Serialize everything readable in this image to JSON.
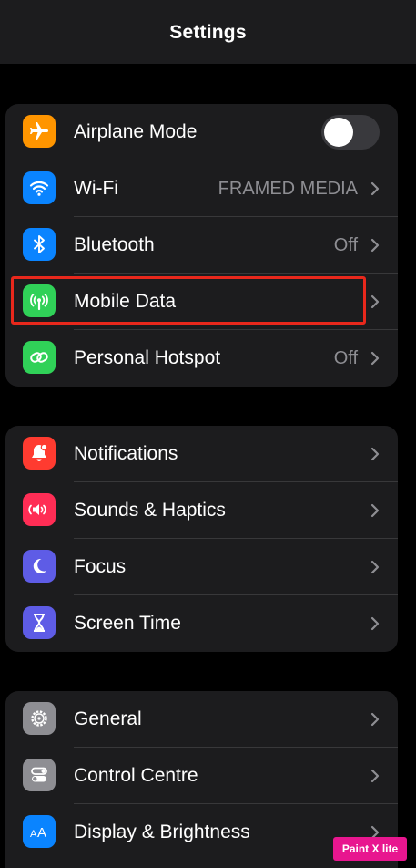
{
  "header": {
    "title": "Settings"
  },
  "group1": {
    "items": [
      {
        "label": "Airplane Mode",
        "icon": "airplane-icon",
        "color": "#ff9500",
        "toggle": false
      },
      {
        "label": "Wi-Fi",
        "value": "FRAMED MEDIA",
        "icon": "wifi-icon",
        "color": "#0a84ff"
      },
      {
        "label": "Bluetooth",
        "value": "Off",
        "icon": "bluetooth-icon",
        "color": "#0a84ff"
      },
      {
        "label": "Mobile Data",
        "icon": "antenna-icon",
        "color": "#30d158",
        "highlighted": true
      },
      {
        "label": "Personal Hotspot",
        "value": "Off",
        "icon": "hotspot-icon",
        "color": "#30d158"
      }
    ]
  },
  "group2": {
    "items": [
      {
        "label": "Notifications",
        "icon": "bell-icon",
        "color": "#ff3b30"
      },
      {
        "label": "Sounds & Haptics",
        "icon": "speaker-icon",
        "color": "#ff2d55"
      },
      {
        "label": "Focus",
        "icon": "moon-icon",
        "color": "#5e5ce6"
      },
      {
        "label": "Screen Time",
        "icon": "hourglass-icon",
        "color": "#5e5ce6"
      }
    ]
  },
  "group3": {
    "items": [
      {
        "label": "General",
        "icon": "gear-icon",
        "color": "#8e8e93"
      },
      {
        "label": "Control Centre",
        "icon": "switches-icon",
        "color": "#8e8e93"
      },
      {
        "label": "Display & Brightness",
        "icon": "text-size-icon",
        "color": "#0a84ff"
      }
    ]
  },
  "watermark": {
    "text": "Paint X lite"
  }
}
